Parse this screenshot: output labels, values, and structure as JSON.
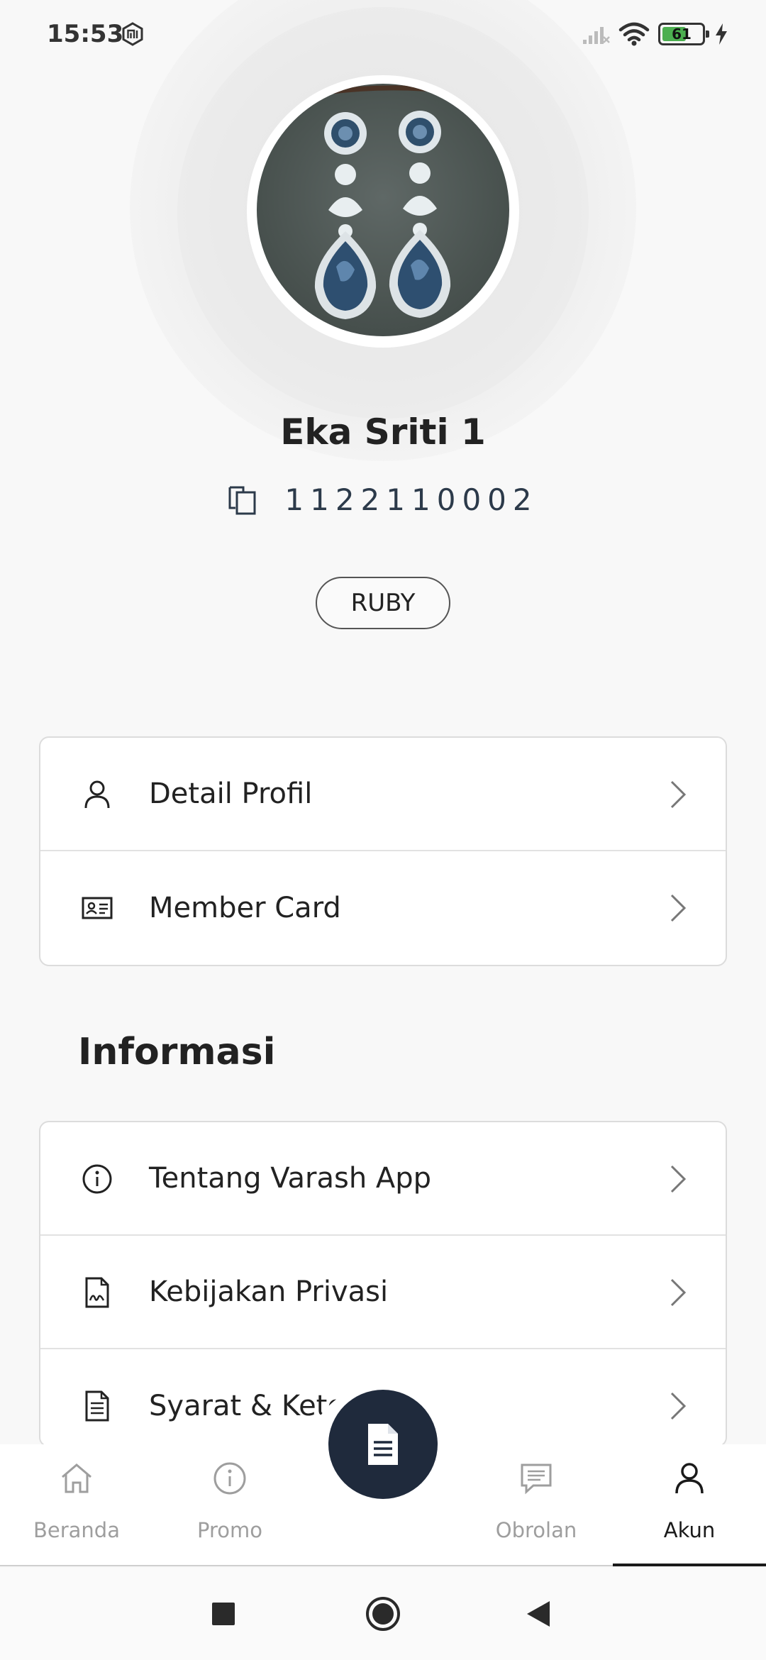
{
  "status_bar": {
    "time": "15:53",
    "battery_level": "61"
  },
  "profile": {
    "name": "Eka Sriti 1",
    "member_id": "1122110002",
    "tier": "RUBY"
  },
  "account_menu": [
    {
      "label": "Detail Profil",
      "icon": "user-icon"
    },
    {
      "label": "Member Card",
      "icon": "id-card-icon"
    }
  ],
  "info_section": {
    "title": "Informasi",
    "items": [
      {
        "label": "Tentang Varash App",
        "icon": "info-icon"
      },
      {
        "label": "Kebijakan Privasi",
        "icon": "document-signature-icon"
      },
      {
        "label": "Syarat & Kete",
        "icon": "document-list-icon"
      }
    ]
  },
  "bottom_nav": {
    "items": [
      {
        "label": "Beranda",
        "icon": "home-icon",
        "active": false
      },
      {
        "label": "Promo",
        "icon": "info-icon",
        "active": false
      },
      {
        "label": "Obrolan",
        "icon": "chat-icon",
        "active": false
      },
      {
        "label": "Akun",
        "icon": "user-icon",
        "active": true
      }
    ],
    "fab_icon": "document-icon"
  },
  "colors": {
    "accent": "#1f2a3c",
    "inactive": "#9e9e9e",
    "battery": "#4caf50"
  }
}
